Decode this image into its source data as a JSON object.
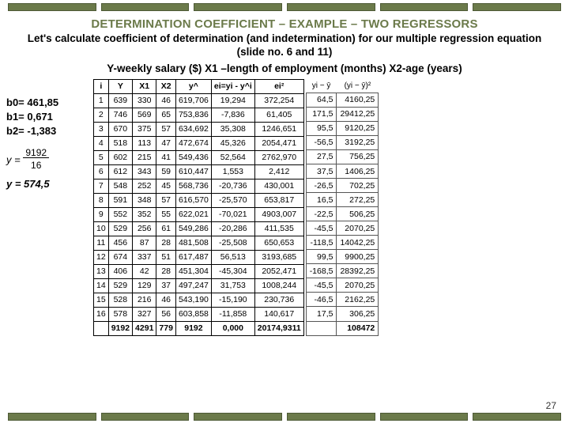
{
  "title": "DETERMINATION COEFFICIENT – EXAMPLE – TWO REGRESSORS",
  "subtitle": "Let's calculate coefficient of determination (and indetermination)  for our multiple regression equation (slide no. 6 and 11)",
  "vars": "Y-weekly salary ($)    X1 –length of employment (months)    X2-age (years)",
  "coeffs": {
    "b0": "b0= 461,85",
    "b1": "b1=  0,671",
    "b2": "b2=  -1,383"
  },
  "ybar_eq1_left": "y =",
  "ybar_eq1_num": "9192",
  "ybar_eq1_den": "16",
  "ybar_eq2": "y = 574,5",
  "headers": [
    "i",
    "Y",
    "X1",
    "X2",
    "y^",
    "ei=yi - y^i",
    "ei²"
  ],
  "extra_headers": [
    "yi − ȳ",
    "(yi − ȳ)²"
  ],
  "rows": [
    [
      "1",
      "639",
      "330",
      "46",
      "619,706",
      "19,294",
      "372,254",
      "64,5",
      "4160,25"
    ],
    [
      "2",
      "746",
      "569",
      "65",
      "753,836",
      "-7,836",
      "61,405",
      "171,5",
      "29412,25"
    ],
    [
      "3",
      "670",
      "375",
      "57",
      "634,692",
      "35,308",
      "1246,651",
      "95,5",
      "9120,25"
    ],
    [
      "4",
      "518",
      "113",
      "47",
      "472,674",
      "45,326",
      "2054,471",
      "-56,5",
      "3192,25"
    ],
    [
      "5",
      "602",
      "215",
      "41",
      "549,436",
      "52,564",
      "2762,970",
      "27,5",
      "756,25"
    ],
    [
      "6",
      "612",
      "343",
      "59",
      "610,447",
      "1,553",
      "2,412",
      "37,5",
      "1406,25"
    ],
    [
      "7",
      "548",
      "252",
      "45",
      "568,736",
      "-20,736",
      "430,001",
      "-26,5",
      "702,25"
    ],
    [
      "8",
      "591",
      "348",
      "57",
      "616,570",
      "-25,570",
      "653,817",
      "16,5",
      "272,25"
    ],
    [
      "9",
      "552",
      "352",
      "55",
      "622,021",
      "-70,021",
      "4903,007",
      "-22,5",
      "506,25"
    ],
    [
      "10",
      "529",
      "256",
      "61",
      "549,286",
      "-20,286",
      "411,535",
      "-45,5",
      "2070,25"
    ],
    [
      "11",
      "456",
      "87",
      "28",
      "481,508",
      "-25,508",
      "650,653",
      "-118,5",
      "14042,25"
    ],
    [
      "12",
      "674",
      "337",
      "51",
      "617,487",
      "56,513",
      "3193,685",
      "99,5",
      "9900,25"
    ],
    [
      "13",
      "406",
      "42",
      "28",
      "451,304",
      "-45,304",
      "2052,471",
      "-168,5",
      "28392,25"
    ],
    [
      "14",
      "529",
      "129",
      "37",
      "497,247",
      "31,753",
      "1008,244",
      "-45,5",
      "2070,25"
    ],
    [
      "15",
      "528",
      "216",
      "46",
      "543,190",
      "-15,190",
      "230,736",
      "-46,5",
      "2162,25"
    ],
    [
      "16",
      "578",
      "327",
      "56",
      "603,858",
      "-11,858",
      "140,617",
      "17,5",
      "306,25"
    ],
    [
      "",
      "9192",
      "4291",
      "779",
      "9192",
      "0,000",
      "20174,9311",
      "",
      "108472"
    ]
  ],
  "slide_num": "27"
}
